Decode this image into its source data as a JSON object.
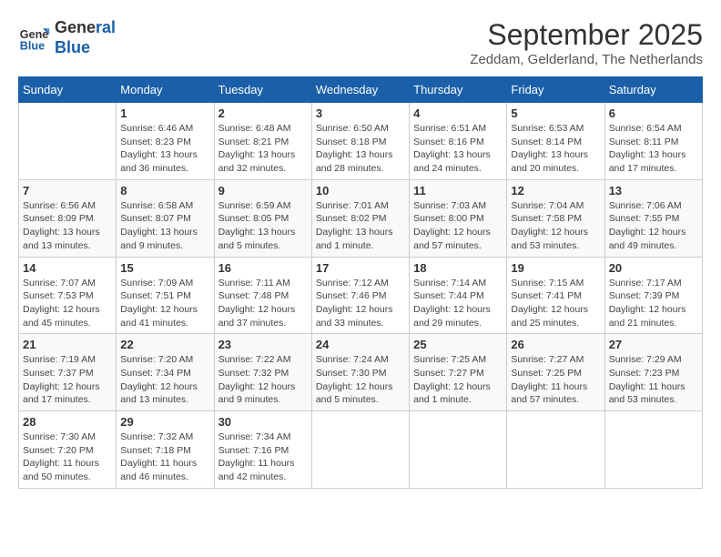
{
  "logo": {
    "line1": "General",
    "line2": "Blue"
  },
  "title": "September 2025",
  "subtitle": "Zeddam, Gelderland, The Netherlands",
  "weekdays": [
    "Sunday",
    "Monday",
    "Tuesday",
    "Wednesday",
    "Thursday",
    "Friday",
    "Saturday"
  ],
  "weeks": [
    [
      {
        "day": "",
        "info": ""
      },
      {
        "day": "1",
        "info": "Sunrise: 6:46 AM\nSunset: 8:23 PM\nDaylight: 13 hours\nand 36 minutes."
      },
      {
        "day": "2",
        "info": "Sunrise: 6:48 AM\nSunset: 8:21 PM\nDaylight: 13 hours\nand 32 minutes."
      },
      {
        "day": "3",
        "info": "Sunrise: 6:50 AM\nSunset: 8:18 PM\nDaylight: 13 hours\nand 28 minutes."
      },
      {
        "day": "4",
        "info": "Sunrise: 6:51 AM\nSunset: 8:16 PM\nDaylight: 13 hours\nand 24 minutes."
      },
      {
        "day": "5",
        "info": "Sunrise: 6:53 AM\nSunset: 8:14 PM\nDaylight: 13 hours\nand 20 minutes."
      },
      {
        "day": "6",
        "info": "Sunrise: 6:54 AM\nSunset: 8:11 PM\nDaylight: 13 hours\nand 17 minutes."
      }
    ],
    [
      {
        "day": "7",
        "info": "Sunrise: 6:56 AM\nSunset: 8:09 PM\nDaylight: 13 hours\nand 13 minutes."
      },
      {
        "day": "8",
        "info": "Sunrise: 6:58 AM\nSunset: 8:07 PM\nDaylight: 13 hours\nand 9 minutes."
      },
      {
        "day": "9",
        "info": "Sunrise: 6:59 AM\nSunset: 8:05 PM\nDaylight: 13 hours\nand 5 minutes."
      },
      {
        "day": "10",
        "info": "Sunrise: 7:01 AM\nSunset: 8:02 PM\nDaylight: 13 hours\nand 1 minute."
      },
      {
        "day": "11",
        "info": "Sunrise: 7:03 AM\nSunset: 8:00 PM\nDaylight: 12 hours\nand 57 minutes."
      },
      {
        "day": "12",
        "info": "Sunrise: 7:04 AM\nSunset: 7:58 PM\nDaylight: 12 hours\nand 53 minutes."
      },
      {
        "day": "13",
        "info": "Sunrise: 7:06 AM\nSunset: 7:55 PM\nDaylight: 12 hours\nand 49 minutes."
      }
    ],
    [
      {
        "day": "14",
        "info": "Sunrise: 7:07 AM\nSunset: 7:53 PM\nDaylight: 12 hours\nand 45 minutes."
      },
      {
        "day": "15",
        "info": "Sunrise: 7:09 AM\nSunset: 7:51 PM\nDaylight: 12 hours\nand 41 minutes."
      },
      {
        "day": "16",
        "info": "Sunrise: 7:11 AM\nSunset: 7:48 PM\nDaylight: 12 hours\nand 37 minutes."
      },
      {
        "day": "17",
        "info": "Sunrise: 7:12 AM\nSunset: 7:46 PM\nDaylight: 12 hours\nand 33 minutes."
      },
      {
        "day": "18",
        "info": "Sunrise: 7:14 AM\nSunset: 7:44 PM\nDaylight: 12 hours\nand 29 minutes."
      },
      {
        "day": "19",
        "info": "Sunrise: 7:15 AM\nSunset: 7:41 PM\nDaylight: 12 hours\nand 25 minutes."
      },
      {
        "day": "20",
        "info": "Sunrise: 7:17 AM\nSunset: 7:39 PM\nDaylight: 12 hours\nand 21 minutes."
      }
    ],
    [
      {
        "day": "21",
        "info": "Sunrise: 7:19 AM\nSunset: 7:37 PM\nDaylight: 12 hours\nand 17 minutes."
      },
      {
        "day": "22",
        "info": "Sunrise: 7:20 AM\nSunset: 7:34 PM\nDaylight: 12 hours\nand 13 minutes."
      },
      {
        "day": "23",
        "info": "Sunrise: 7:22 AM\nSunset: 7:32 PM\nDaylight: 12 hours\nand 9 minutes."
      },
      {
        "day": "24",
        "info": "Sunrise: 7:24 AM\nSunset: 7:30 PM\nDaylight: 12 hours\nand 5 minutes."
      },
      {
        "day": "25",
        "info": "Sunrise: 7:25 AM\nSunset: 7:27 PM\nDaylight: 12 hours\nand 1 minute."
      },
      {
        "day": "26",
        "info": "Sunrise: 7:27 AM\nSunset: 7:25 PM\nDaylight: 11 hours\nand 57 minutes."
      },
      {
        "day": "27",
        "info": "Sunrise: 7:29 AM\nSunset: 7:23 PM\nDaylight: 11 hours\nand 53 minutes."
      }
    ],
    [
      {
        "day": "28",
        "info": "Sunrise: 7:30 AM\nSunset: 7:20 PM\nDaylight: 11 hours\nand 50 minutes."
      },
      {
        "day": "29",
        "info": "Sunrise: 7:32 AM\nSunset: 7:18 PM\nDaylight: 11 hours\nand 46 minutes."
      },
      {
        "day": "30",
        "info": "Sunrise: 7:34 AM\nSunset: 7:16 PM\nDaylight: 11 hours\nand 42 minutes."
      },
      {
        "day": "",
        "info": ""
      },
      {
        "day": "",
        "info": ""
      },
      {
        "day": "",
        "info": ""
      },
      {
        "day": "",
        "info": ""
      }
    ]
  ]
}
